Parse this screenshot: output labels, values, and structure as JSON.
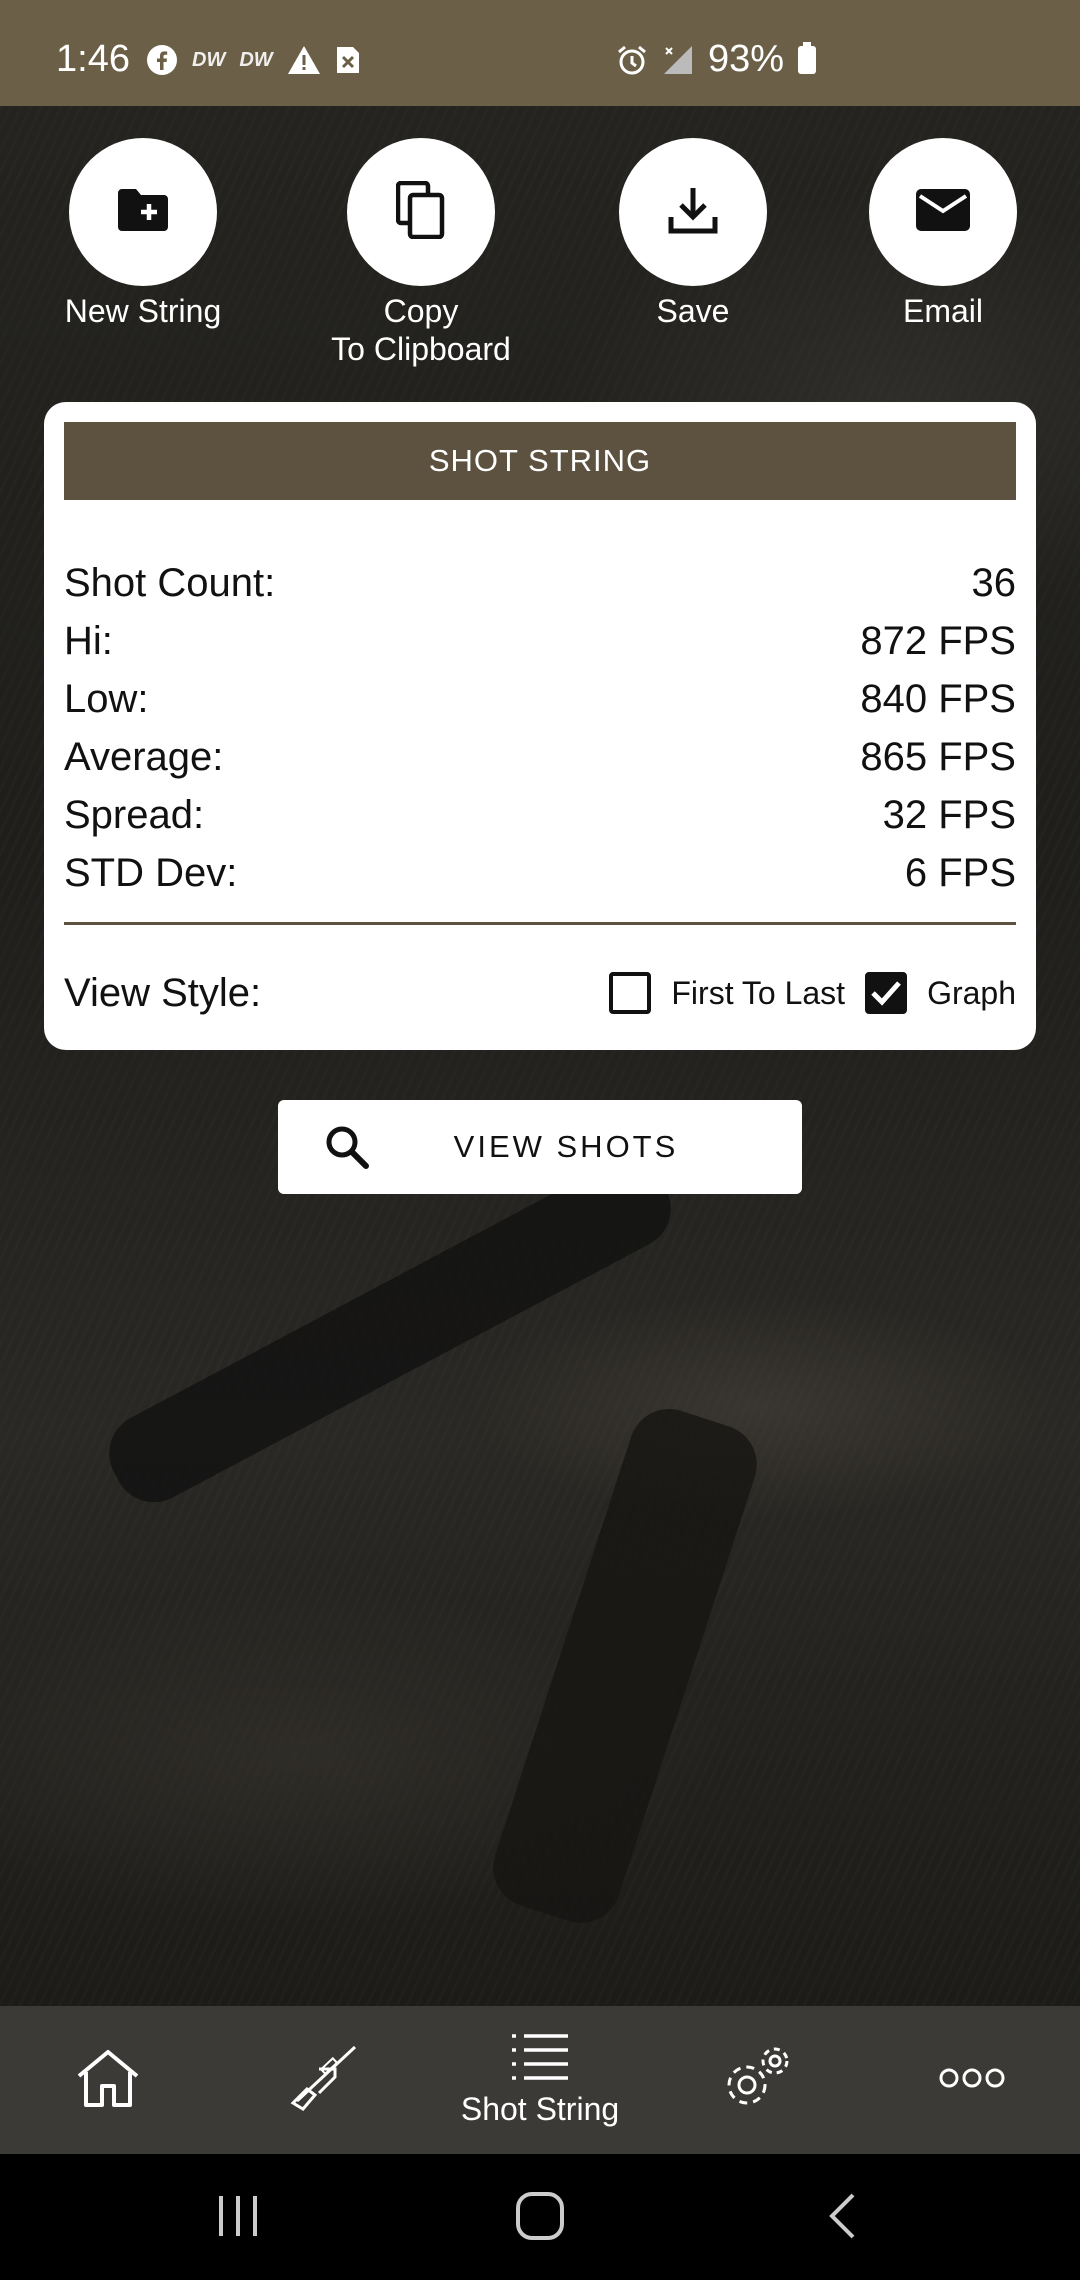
{
  "status_bar": {
    "time": "1:46",
    "battery": "93%",
    "icons": [
      "facebook-icon",
      "dw-icon",
      "dw-icon",
      "warning-icon",
      "sim-icon",
      "alarm-icon",
      "signal-icon",
      "battery-icon"
    ],
    "dw_text": "DW"
  },
  "actions": {
    "new_string": "New String",
    "copy_line1": "Copy",
    "copy_line2": "To Clipboard",
    "save": "Save",
    "email": "Email"
  },
  "card": {
    "header": "SHOT STRING",
    "stats": [
      {
        "label": "Shot Count:",
        "value": "36"
      },
      {
        "label": "Hi:",
        "value": "872 FPS"
      },
      {
        "label": "Low:",
        "value": "840 FPS"
      },
      {
        "label": "Average:",
        "value": "865 FPS"
      },
      {
        "label": "Spread:",
        "value": "32 FPS"
      },
      {
        "label": "STD Dev:",
        "value": "6 FPS"
      }
    ],
    "view_style_label": "View Style:",
    "first_to_last_label": "First To Last",
    "first_to_last_checked": false,
    "graph_label": "Graph",
    "graph_checked": true
  },
  "view_shots": {
    "label": "VIEW SHOTS",
    "icon": "search-icon"
  },
  "bottom_nav": {
    "items": [
      {
        "icon": "home-icon",
        "label": ""
      },
      {
        "icon": "rifle-icon",
        "label": ""
      },
      {
        "icon": "list-icon",
        "label": "Shot String",
        "active": true
      },
      {
        "icon": "settings-icon",
        "label": ""
      },
      {
        "icon": "more-icon",
        "label": ""
      }
    ]
  },
  "colors": {
    "status_bar": "#6b5f47",
    "header": "#5d5240",
    "nav_bar": "#3b3a37"
  }
}
